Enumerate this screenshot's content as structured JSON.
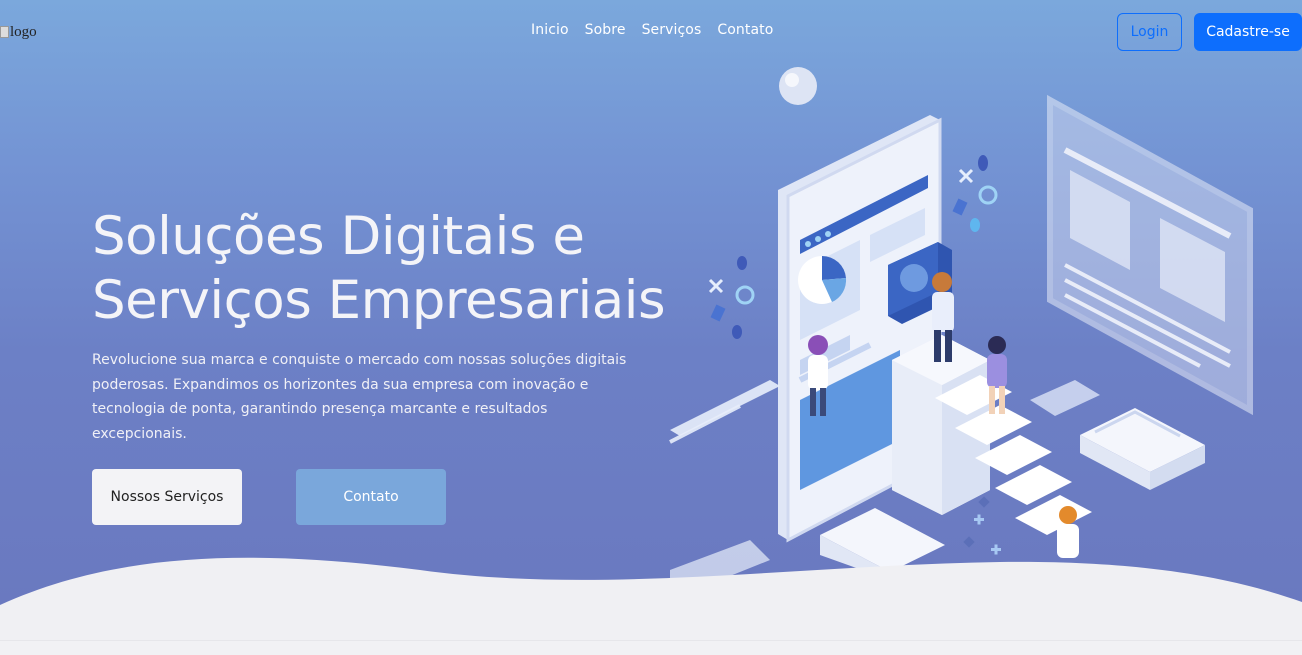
{
  "header": {
    "logo_alt": "logo",
    "nav": [
      "Inicio",
      "Sobre",
      "Serviços",
      "Contato"
    ],
    "login_label": "Login",
    "signup_label": "Cadastre-se"
  },
  "hero": {
    "title_line1": "Soluções Digitais e",
    "title_line2": "Serviços Empresariais",
    "description": "Revolucione sua marca e conquiste o mercado com nossas soluções digitais poderosas. Expandimos os horizontes da sua empresa com inovação e tecnologia de ponta, garantindo presença marcante e resultados excepcionais.",
    "primary_button": "Nossos Serviços",
    "secondary_button": "Contato"
  },
  "colors": {
    "accent": "#0d6efd",
    "hero_top": "#7ba8dc",
    "hero_bottom": "#6a78bf",
    "contact_button": "#7aa7db"
  }
}
